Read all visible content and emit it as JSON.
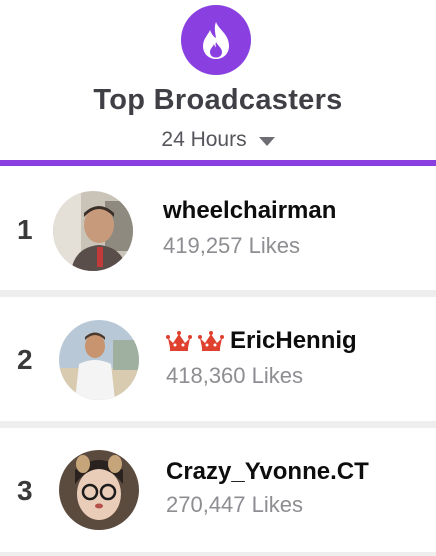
{
  "header": {
    "title": "Top Broadcasters",
    "period": "24 Hours"
  },
  "colors": {
    "accent": "#8a3fe0",
    "crown": "#e0402e"
  },
  "broadcasters": [
    {
      "rank": "1",
      "name": "wheelchairman",
      "likes": "419,257 Likes",
      "crowns": 0
    },
    {
      "rank": "2",
      "name": "EricHennig",
      "likes": "418,360 Likes",
      "crowns": 2
    },
    {
      "rank": "3",
      "name": "Crazy_Yvonne.CT",
      "likes": "270,447 Likes",
      "crowns": 0
    }
  ]
}
